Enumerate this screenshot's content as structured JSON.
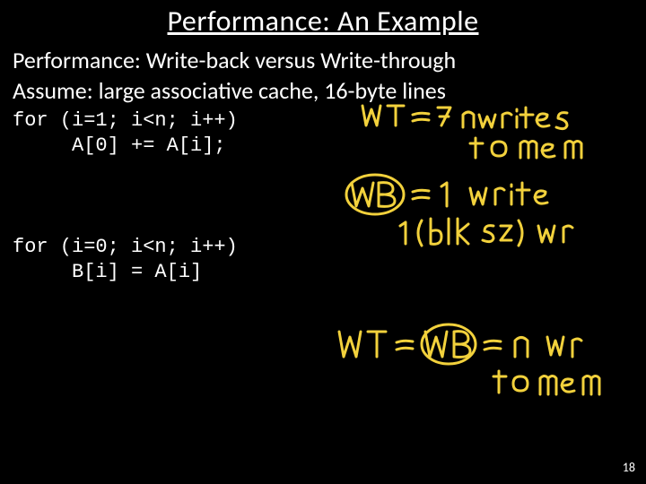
{
  "title": "Performance: An Example",
  "subtitle": "Performance: Write-back versus Write-through",
  "assume": "Assume: large associative cache, 16-byte lines",
  "code1_line1": "for (i=1; i<n; i++)",
  "code1_line2": "     A[0] += A[i];",
  "code2_line1": "for (i=0; i<n; i++)",
  "code2_line2": "     B[i] = A[i]",
  "page_number": "18",
  "annotations": {
    "wt1": "WT = 7 nwrites",
    "wt1b": "to mem",
    "wb1": "WB = 1 write",
    "wb1b": "1 (blk sz) wr",
    "eq2": "WT = WB = n wr",
    "eq2b": "to mem"
  }
}
